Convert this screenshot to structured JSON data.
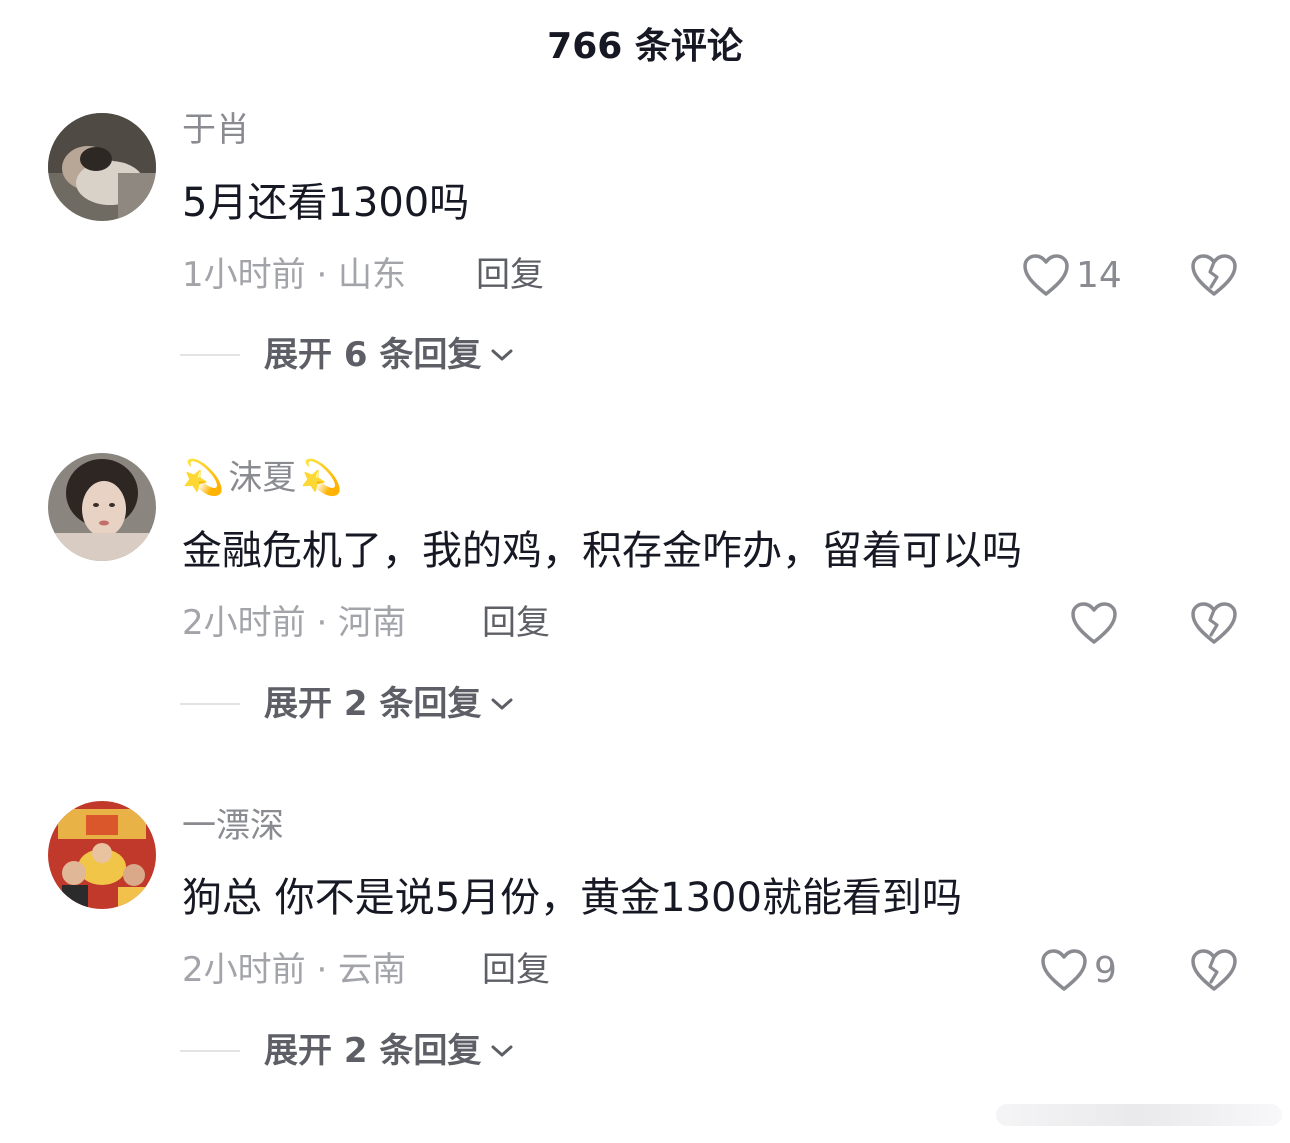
{
  "header": {
    "title": "766 条评论"
  },
  "comments": [
    {
      "username": "于肖",
      "emoji": "",
      "text": "5月还看1300吗",
      "meta": "1小时前 · 山东",
      "reply_label": "回复",
      "like_count": "14",
      "expand_label": "展开 6 条回复"
    },
    {
      "username": "沫夏",
      "emoji": "💫",
      "text": "金融危机了，我的鸡，积存金咋办，留着可以吗",
      "meta": "2小时前 · 河南",
      "reply_label": "回复",
      "like_count": "",
      "expand_label": "展开 2 条回复"
    },
    {
      "username": "一漂深",
      "emoji": "",
      "text": "狗总 你不是说5月份，黄金1300就能看到吗",
      "meta": "2小时前 · 云南",
      "reply_label": "回复",
      "like_count": "9",
      "expand_label": "展开 2 条回复"
    }
  ],
  "icons": {
    "like": "heart-outline-icon",
    "dislike": "broken-heart-icon",
    "expand": "chevron-down-icon"
  },
  "colors": {
    "primary_text": "#161823",
    "secondary_text": "#8a8b91",
    "tertiary_text": "#a3a4a9",
    "reply_text": "#5e5f66",
    "divider": "#e3e3e5"
  }
}
